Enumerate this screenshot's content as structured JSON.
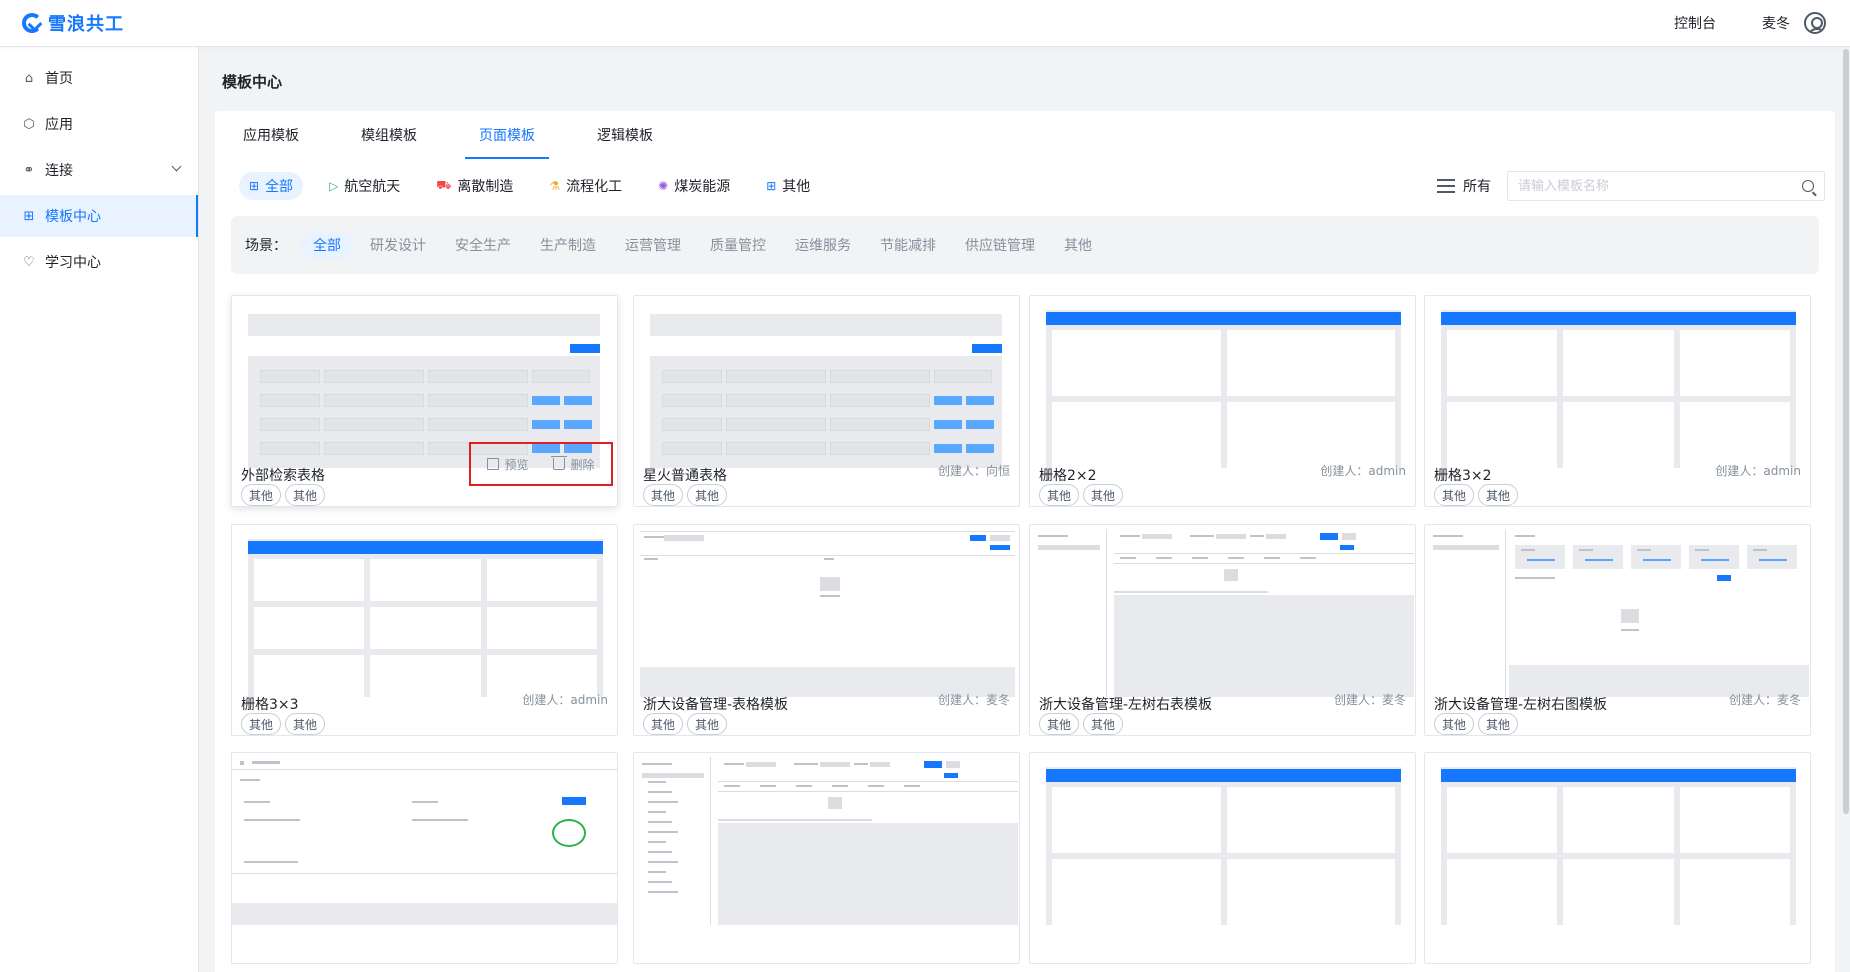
{
  "app": {
    "name": "雪浪共工"
  },
  "header": {
    "console_label": "控制台",
    "user_name": "麦冬"
  },
  "sidebar": {
    "items": [
      {
        "label": "首页",
        "icon": "home-icon"
      },
      {
        "label": "应用",
        "icon": "cube-icon"
      },
      {
        "label": "连接",
        "icon": "connect-icon",
        "expandable": true
      },
      {
        "label": "模板中心",
        "icon": "grid-icon",
        "active": true
      },
      {
        "label": "学习中心",
        "icon": "bulb-icon"
      }
    ]
  },
  "page": {
    "title": "模板中心"
  },
  "tabs": [
    {
      "label": "应用模板"
    },
    {
      "label": "模组模板"
    },
    {
      "label": "页面模板",
      "active": true
    },
    {
      "label": "逻辑模板"
    }
  ],
  "industries": [
    {
      "label": "全部",
      "icon": "grid-icon",
      "color": "#1677ff",
      "active": true
    },
    {
      "label": "航空航天",
      "icon": "plane-icon",
      "color": "#36b37e"
    },
    {
      "label": "离散制造",
      "icon": "car-icon",
      "color": "#f5484a"
    },
    {
      "label": "流程化工",
      "icon": "flask-icon",
      "color": "#f5a623"
    },
    {
      "label": "煤炭能源",
      "icon": "energy-icon",
      "color": "#9b59e6"
    },
    {
      "label": "其他",
      "icon": "apps-icon",
      "color": "#1677ff"
    }
  ],
  "scope": {
    "label": "所有"
  },
  "search": {
    "placeholder": "请输入模板名称"
  },
  "scenes": {
    "label": "场景：",
    "items": [
      {
        "label": "全部",
        "active": true
      },
      {
        "label": "研发设计"
      },
      {
        "label": "安全生产"
      },
      {
        "label": "生产制造"
      },
      {
        "label": "运营管理"
      },
      {
        "label": "质量管控"
      },
      {
        "label": "运维服务"
      },
      {
        "label": "节能减排"
      },
      {
        "label": "供应链管理"
      },
      {
        "label": "其他"
      }
    ]
  },
  "card_actions": {
    "preview": "预览",
    "delete": "删除"
  },
  "cards": [
    {
      "title": "外部检索表格",
      "creator": "",
      "tags": [
        "其他",
        "其他"
      ],
      "thumb": "table",
      "hover": true
    },
    {
      "title": "星火普通表格",
      "creator": "创建人：向恒",
      "tags": [
        "其他",
        "其他"
      ],
      "thumb": "table"
    },
    {
      "title": "栅格2×2",
      "creator": "创建人：admin",
      "tags": [
        "其他",
        "其他"
      ],
      "thumb": "grid2"
    },
    {
      "title": "栅格3×2",
      "creator": "创建人：admin",
      "tags": [
        "其他",
        "其他"
      ],
      "thumb": "grid32"
    },
    {
      "title": "栅格3×3",
      "creator": "创建人：admin",
      "tags": [
        "其他",
        "其他"
      ],
      "thumb": "grid33"
    },
    {
      "title": "浙大设备管理-表格模板",
      "creator": "创建人：麦冬",
      "tags": [
        "其他",
        "其他"
      ],
      "thumb": "form"
    },
    {
      "title": "浙大设备管理-左树右表模板",
      "creator": "创建人：麦冬",
      "tags": [
        "其他",
        "其他"
      ],
      "thumb": "tree"
    },
    {
      "title": "浙大设备管理-左树右图模板",
      "creator": "创建人：麦冬",
      "tags": [
        "其他",
        "其他"
      ],
      "thumb": "treechart"
    },
    {
      "title": "",
      "creator": "",
      "tags": [],
      "thumb": "detail"
    },
    {
      "title": "",
      "creator": "",
      "tags": [],
      "thumb": "tree2"
    },
    {
      "title": "",
      "creator": "",
      "tags": [],
      "thumb": "grid2"
    },
    {
      "title": "",
      "creator": "",
      "tags": [],
      "thumb": "grid32"
    }
  ]
}
